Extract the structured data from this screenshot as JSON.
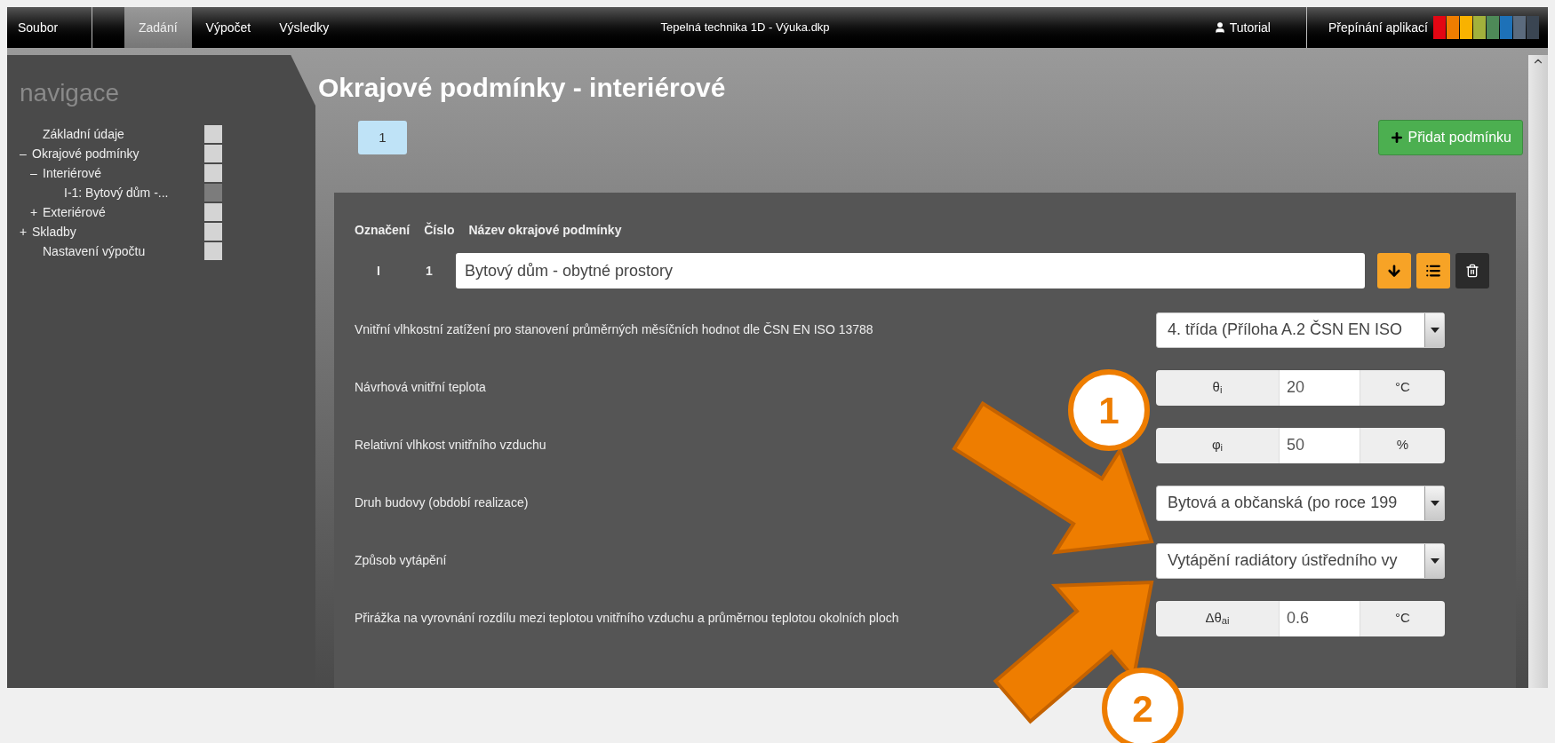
{
  "menu_bar": {
    "file_menu": "Soubor",
    "tabs": [
      {
        "label": "Zadání",
        "selected": true
      },
      {
        "label": "Výpočet",
        "selected": false
      },
      {
        "label": "Výsledky",
        "selected": false
      }
    ],
    "title": "Tepelná technika 1D - Výuka.dkp",
    "tutorial": "Tutorial",
    "app_switch": {
      "label": "Přepínání aplikací",
      "apps": [
        {
          "color": "#e30613"
        },
        {
          "color": "#ef7d00"
        },
        {
          "color": "#f9b200"
        },
        {
          "color": "#a2b13c"
        },
        {
          "color": "#4e8a58"
        },
        {
          "color": "#1d71b8"
        },
        {
          "color": "#5b6b7e"
        },
        {
          "color": "#3a4552"
        }
      ]
    }
  },
  "sidebar": {
    "heading": "navigace",
    "items": [
      {
        "label": "Základní údaje",
        "color": "#d4d4d4"
      },
      {
        "label": "Okrajové podmínky",
        "marker": "–",
        "color": "#d4d4d4",
        "children": [
          {
            "label": "Interiérové",
            "marker": "–",
            "color": "#d4d4d4",
            "children": [
              {
                "label": "I-1: Bytový dům -...",
                "color": "#7c7c7c"
              }
            ]
          },
          {
            "label": "Exteriérové",
            "marker": "+",
            "color": "#d4d4d4"
          }
        ]
      },
      {
        "label": "Skladby",
        "marker": "+",
        "color": "#d4d4d4"
      },
      {
        "label": "Nastavení výpočtu",
        "color": "#d4d4d4"
      }
    ]
  },
  "main": {
    "title": "Okrajové podmínky - interiérové",
    "condition_tabs": [
      {
        "label": "1",
        "selected": true
      }
    ],
    "add_button": "Přidat podmínku",
    "panel": {
      "columns": [
        "Označení",
        "Číslo",
        "Název okrajové podmínky"
      ],
      "condition": {
        "mark": "I",
        "number": "1",
        "name": "Bytový dům - obytné prostory"
      },
      "actions": [
        {
          "kind": "move-down"
        },
        {
          "kind": "list"
        },
        {
          "kind": "delete"
        }
      ],
      "fields": [
        {
          "kind": "select",
          "label": "Vnitřní vlhkostní zatížení pro stanovení průměrných měsíčních hodnot dle ČSN EN ISO 13788",
          "value": "4. třída (Příloha A.2 ČSN EN ISO"
        },
        {
          "kind": "quantity",
          "label": "Návrhová vnitřní teplota",
          "symbol": "θ$_{i}$",
          "value": "20",
          "unit": "°C"
        },
        {
          "kind": "quantity",
          "label": "Relativní vlhkost vnitřního vzduchu",
          "symbol": "φ$_{i}$",
          "value": "50",
          "unit": "%"
        },
        {
          "kind": "select",
          "label": "Druh budovy (období realizace)",
          "value": "Bytová a občanská (po roce 199"
        },
        {
          "kind": "select",
          "label": "Způsob vytápění",
          "value": "Vytápění radiátory ústředního vy"
        },
        {
          "kind": "quantity",
          "label": "Přirážka na vyrovnání rozdílu mezi teplotou vnitřního vzduchu a průměrnou teplotou okolních ploch",
          "symbol": "Δθ$_{ai}$",
          "value": "0.6",
          "unit": "°C"
        }
      ]
    }
  },
  "callouts": [
    {
      "number": "1"
    },
    {
      "number": "2"
    }
  ]
}
